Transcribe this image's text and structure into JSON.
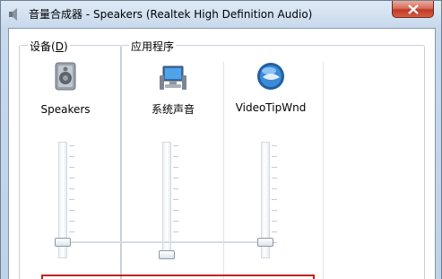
{
  "window": {
    "title": "音量合成器 - Speakers (Realtek High Definition Audio)",
    "title_icon": "speaker-icon"
  },
  "groups": {
    "device_prefix": "设备(",
    "device_key": "D",
    "device_suffix": ")",
    "apps_label": "应用程序"
  },
  "channels": [
    {
      "name": "Speakers",
      "icon": "speaker-device-icon",
      "level": 0.0
    },
    {
      "name": "系统声音",
      "icon": "system-sounds-icon",
      "level": 0.0
    },
    {
      "name": "VideoTipWnd",
      "icon": "videotipwnd-icon",
      "level": 0.0
    }
  ],
  "colors": {
    "highlight_box": "#c0241f",
    "close_button": "#c0392b"
  }
}
